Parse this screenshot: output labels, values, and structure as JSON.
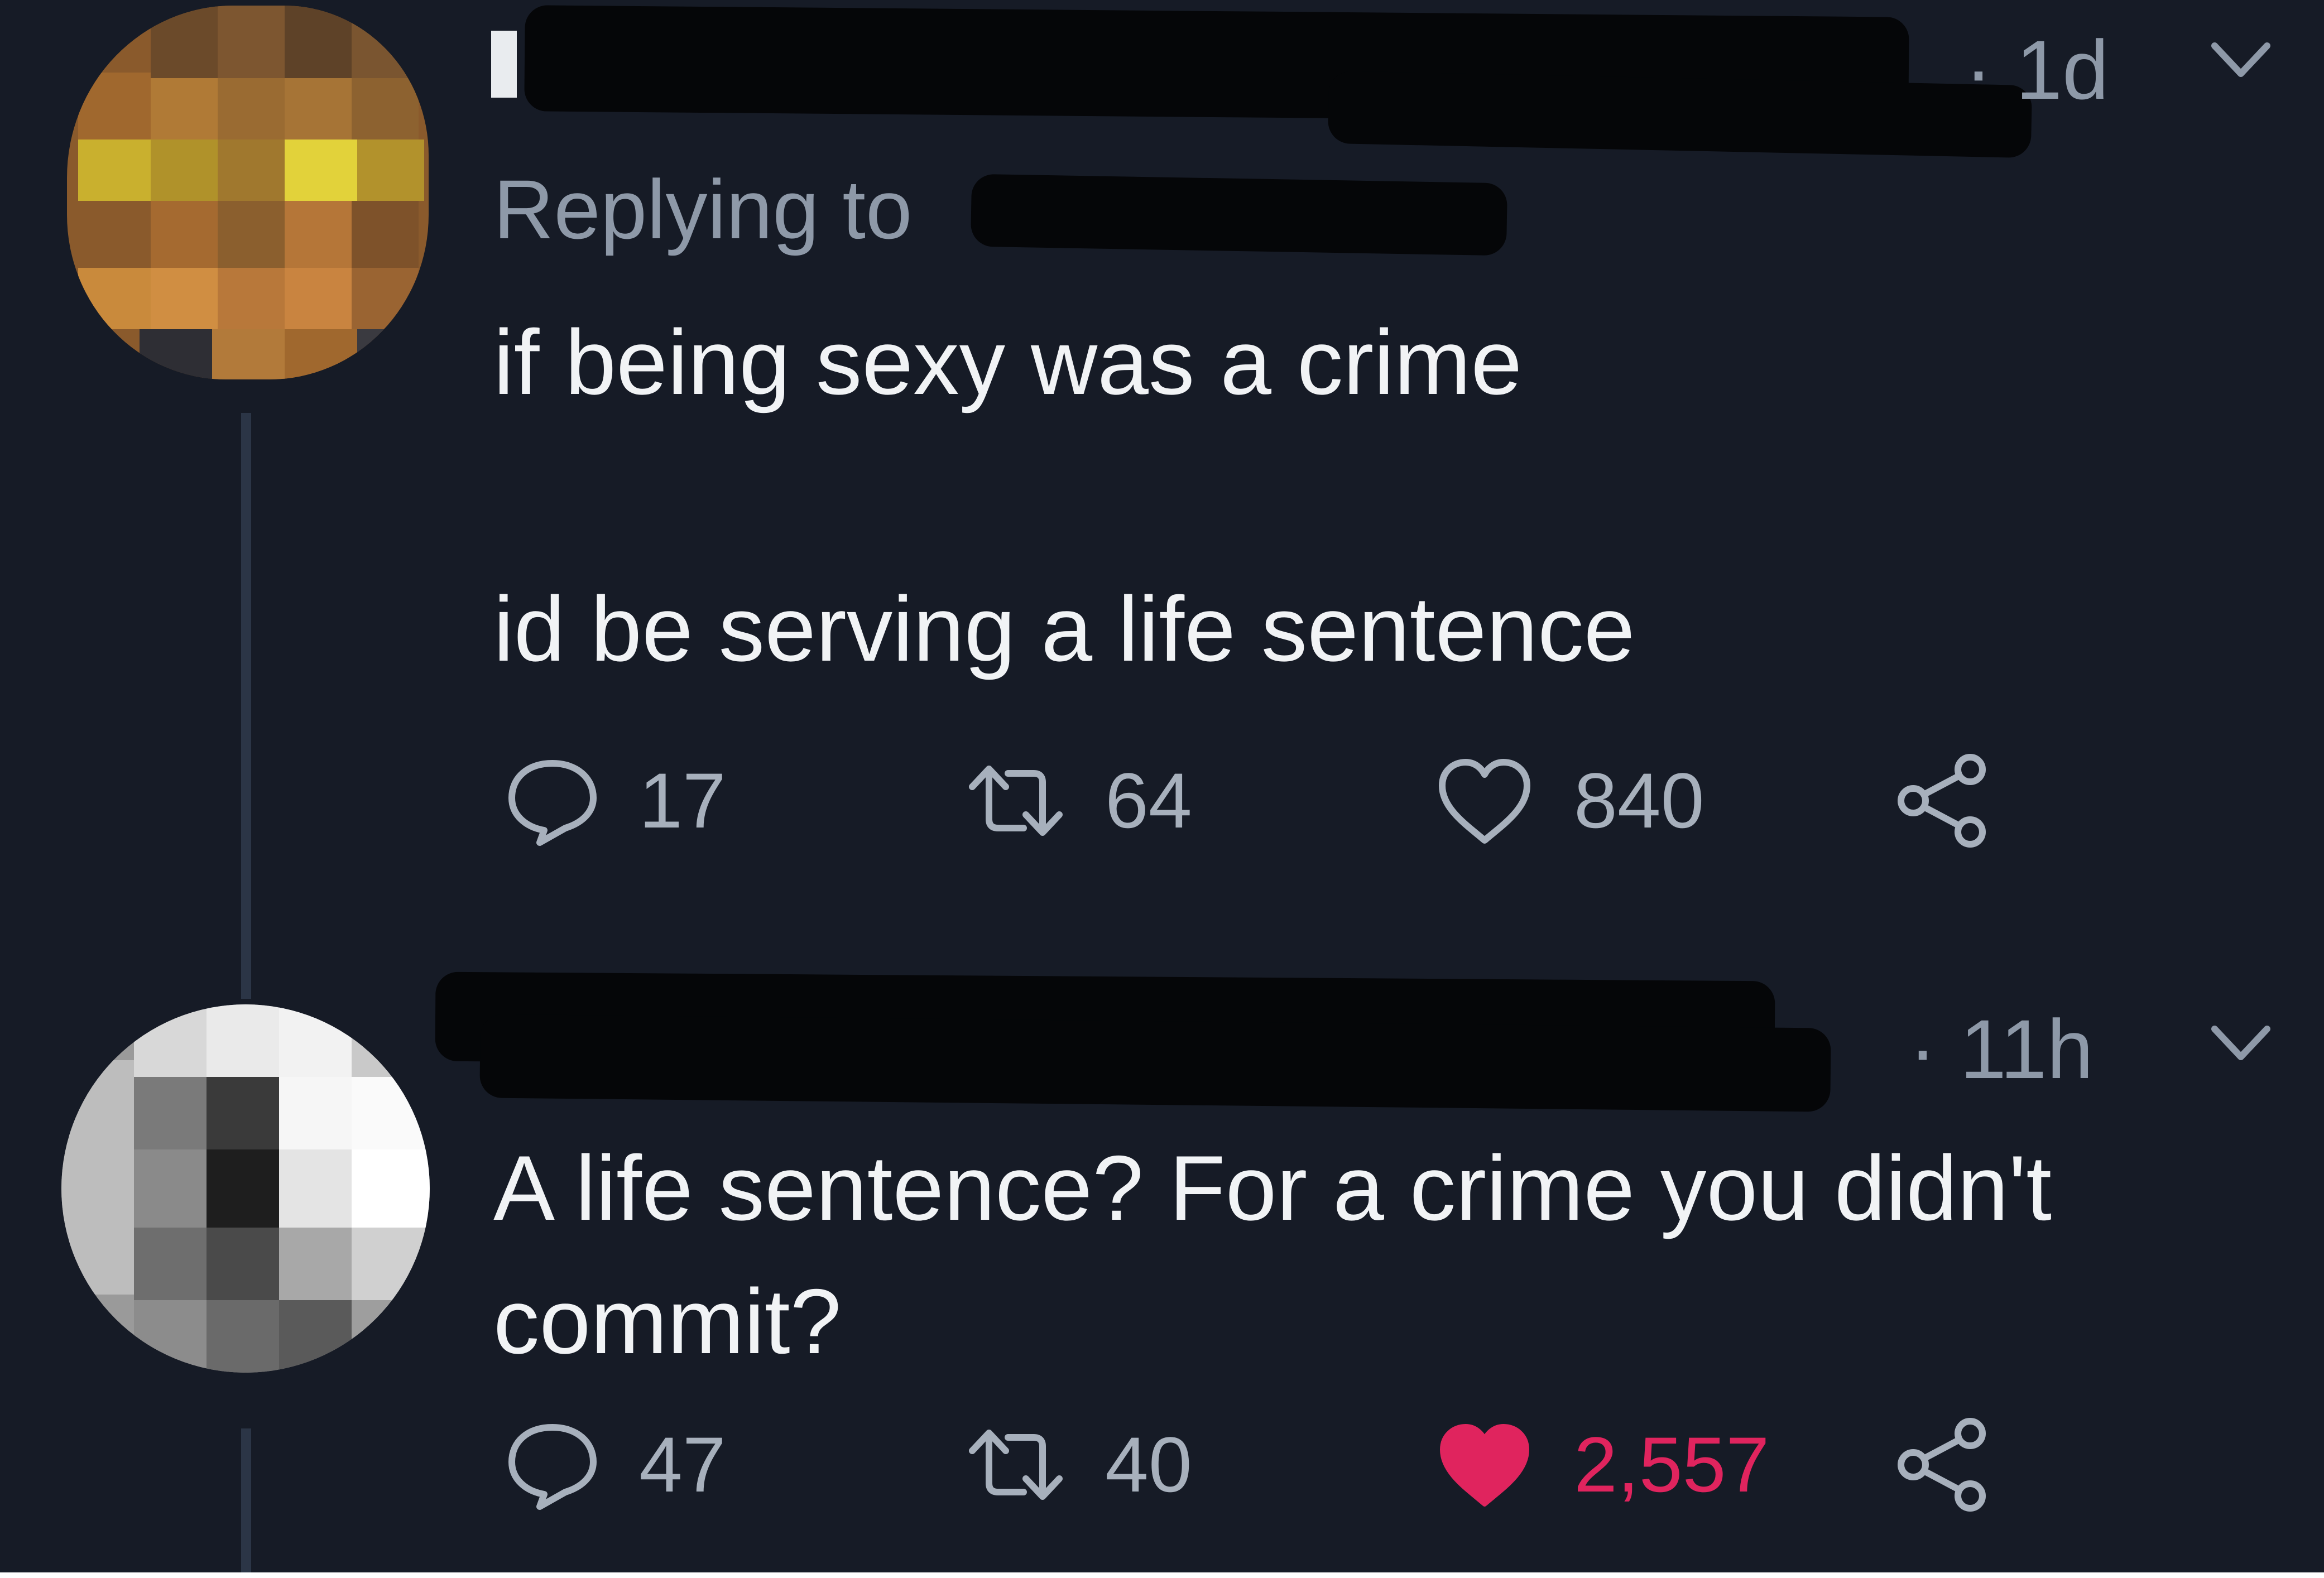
{
  "colors": {
    "background": "#161b26",
    "text": "#f1f3f5",
    "muted": "#8e99a8",
    "like_active": "#e0245e"
  },
  "tweet1": {
    "time": "· 1d",
    "replying_to_label": "Replying to",
    "text_lines": [
      "if being sexy was a crime",
      "",
      "id be serving a life sentence"
    ],
    "reply_count": "17",
    "retweet_count": "64",
    "like_count": "840",
    "liked": false
  },
  "tweet2": {
    "time": "· 11h",
    "text_lines": [
      "A life sentence? For a crime you didn't",
      "commit?"
    ],
    "reply_count": "47",
    "retweet_count": "40",
    "like_count": "2,557",
    "liked": true
  },
  "icons": {
    "reply": "speech-bubble-icon",
    "retweet": "retweet-icon",
    "like": "heart-icon",
    "share": "share-icon",
    "menu": "chevron-down-icon"
  }
}
